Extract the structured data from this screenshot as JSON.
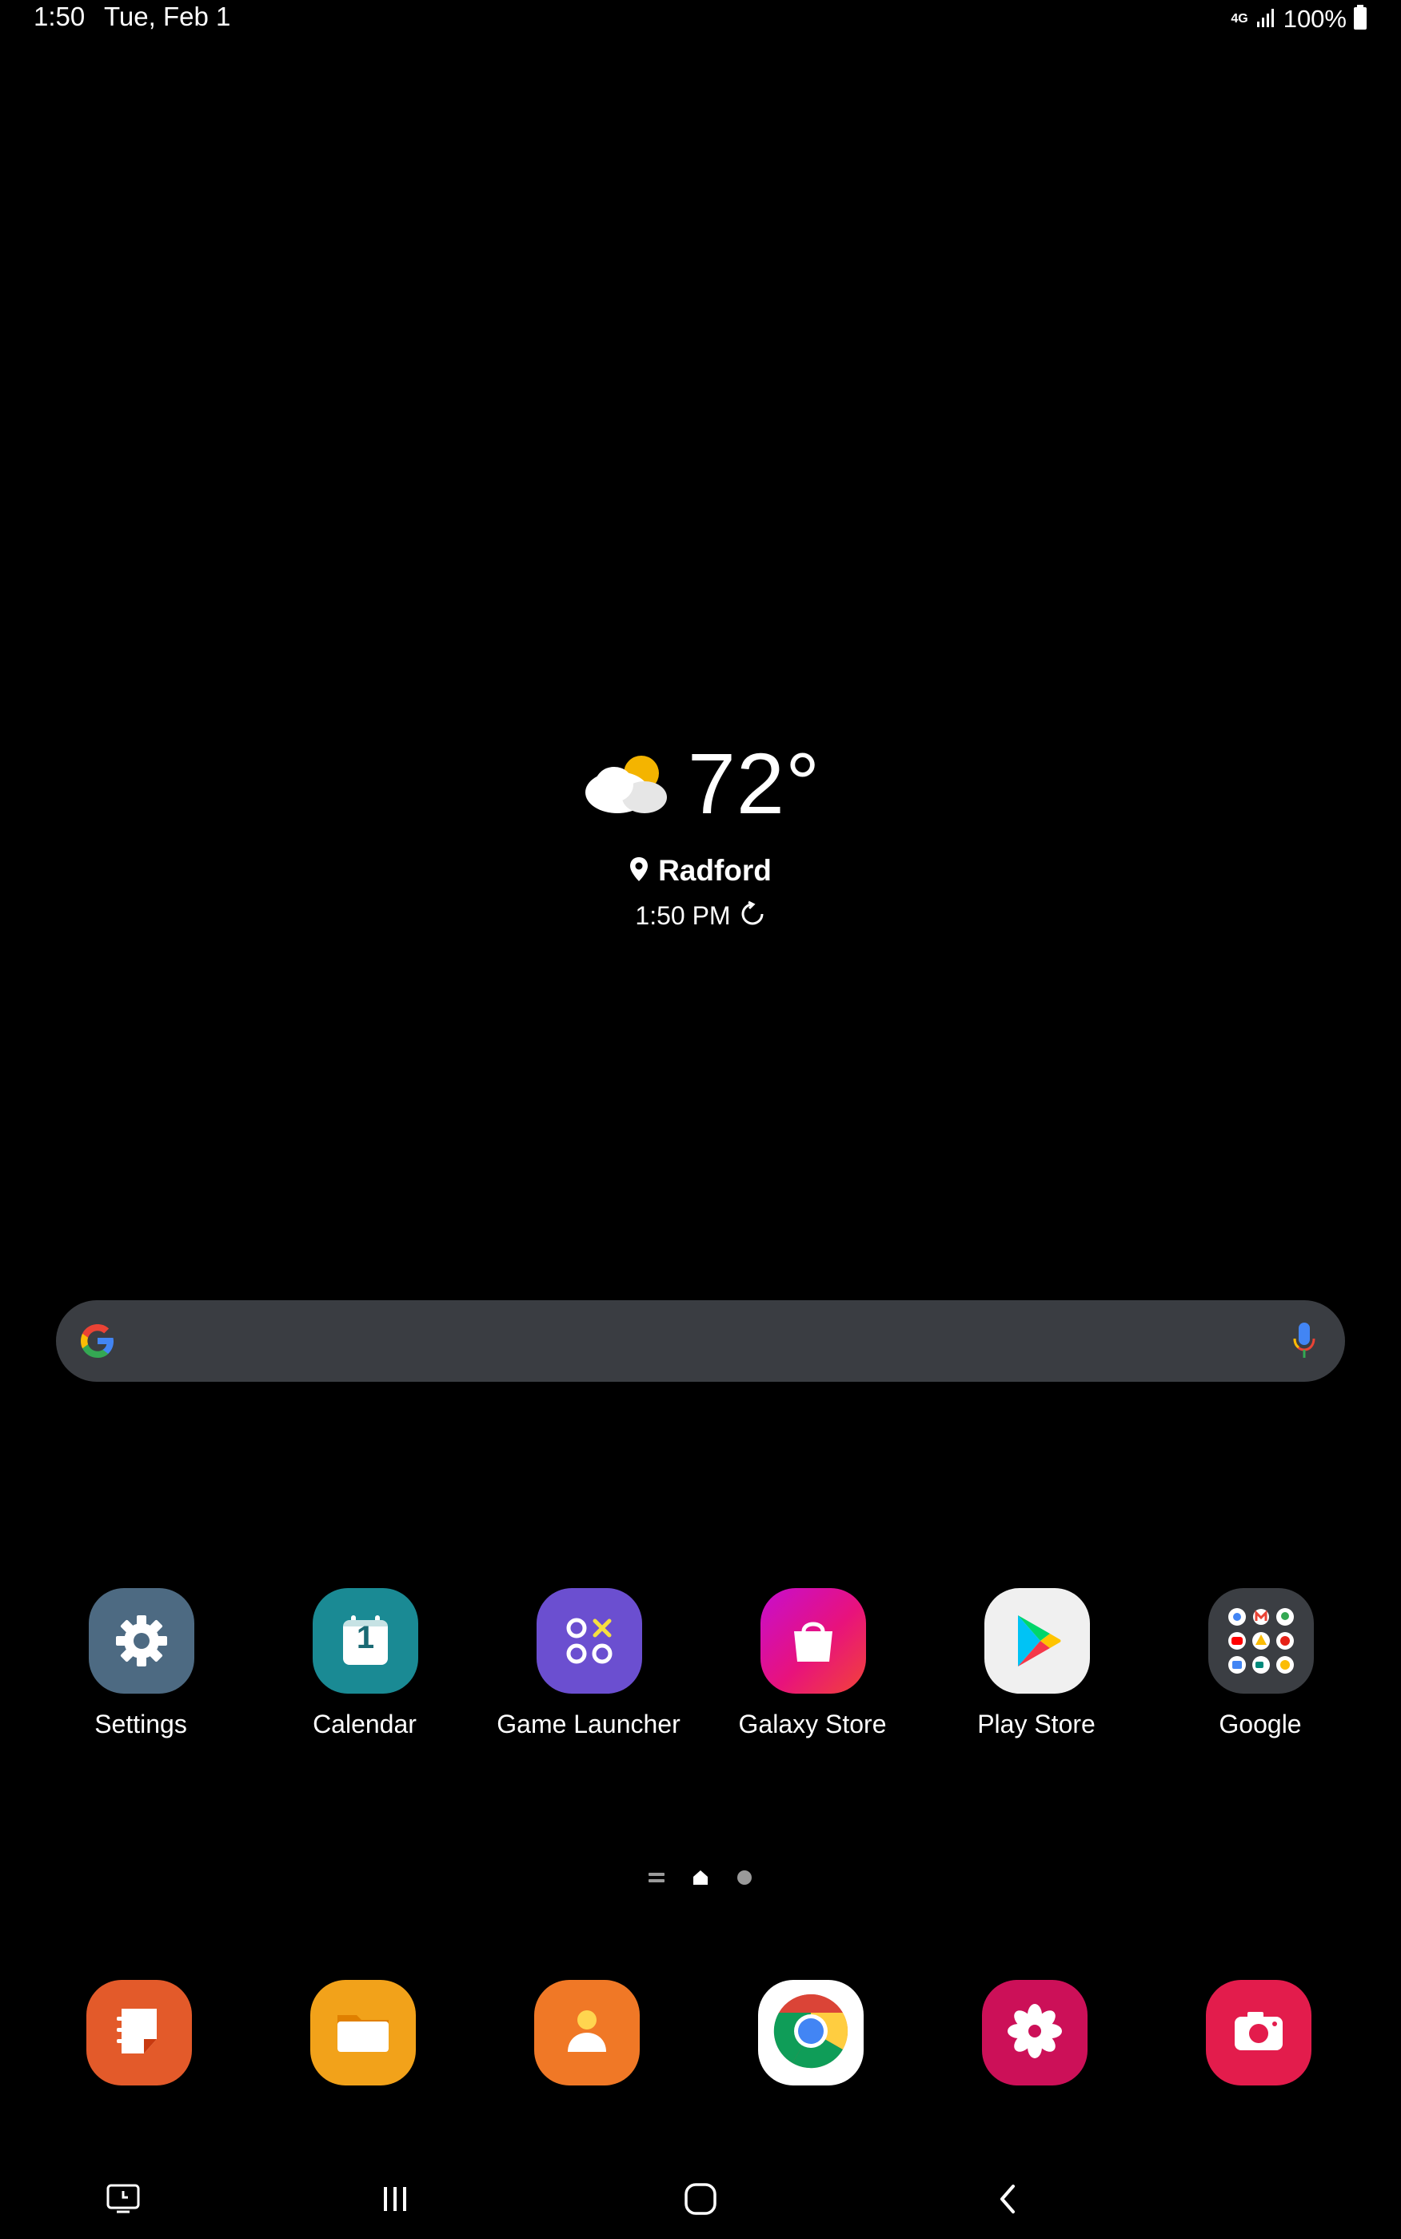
{
  "status_bar": {
    "time": "1:50",
    "date": "Tue, Feb 1",
    "network": "4G",
    "battery": "100%",
    "icons": [
      "network-4g-icon",
      "signal-icon",
      "battery-icon"
    ]
  },
  "weather": {
    "icon": "partly-cloudy-icon",
    "temperature": "72°",
    "location": "Radford",
    "updated_time": "1:50 PM",
    "location_icon": "location-pin-icon",
    "refresh_icon": "refresh-icon"
  },
  "search": {
    "placeholder": "",
    "logo_icon": "google-g-icon",
    "mic_icon": "mic-icon"
  },
  "apps": [
    {
      "label": "Settings",
      "icon": "settings-gear-icon",
      "color": "#4d6a82"
    },
    {
      "label": "Calendar",
      "icon": "calendar-icon",
      "color": "#1a8a94",
      "day": "1"
    },
    {
      "label": "Game Launcher",
      "icon": "game-launcher-icon",
      "color": "#6b4fd0"
    },
    {
      "label": "Galaxy Store",
      "icon": "shopping-bag-icon",
      "color": "#e0127e"
    },
    {
      "label": "Play Store",
      "icon": "play-store-icon",
      "color": "#f0f0f0"
    },
    {
      "label": "Google",
      "icon": "google-folder-icon",
      "color": "#3b3e43"
    }
  ],
  "page_indicator": {
    "current_page": "home",
    "icons": [
      "menu-lines-icon",
      "home-icon",
      "dot-icon"
    ]
  },
  "dock": [
    {
      "name": "samsung-notes",
      "icon": "notes-icon",
      "color": "#e35a2a"
    },
    {
      "name": "my-files",
      "icon": "folder-icon",
      "color": "#f2a21a"
    },
    {
      "name": "contacts",
      "icon": "contact-person-icon",
      "color": "#f07826"
    },
    {
      "name": "chrome",
      "icon": "chrome-icon",
      "color": "#ffffff"
    },
    {
      "name": "gallery",
      "icon": "flower-icon",
      "color": "#cc1058"
    },
    {
      "name": "camera",
      "icon": "camera-icon",
      "color": "#e31c4c"
    }
  ],
  "navbar": {
    "icons": [
      "recent-screen-icon",
      "recent-apps-icon",
      "home-button-icon",
      "back-icon"
    ]
  }
}
